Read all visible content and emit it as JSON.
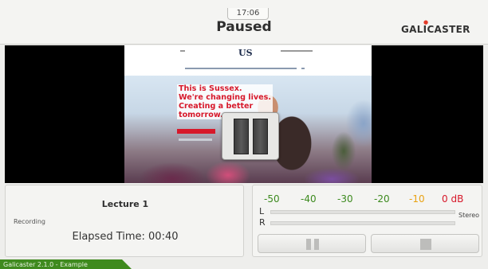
{
  "header": {
    "clock": "17:06",
    "status": "Paused",
    "logo": "GALICASTER"
  },
  "preview": {
    "site_logo": "US",
    "headline": [
      "This is Sussex.",
      "We're changing lives.",
      "Creating a better",
      "tomorrow."
    ]
  },
  "recording": {
    "title": "Lecture 1",
    "status_label": "Recording",
    "elapsed": "Elapsed Time: 00:40"
  },
  "audio": {
    "scale": [
      {
        "label": "-50",
        "color": "#3c8a1e"
      },
      {
        "label": "-40",
        "color": "#3c8a1e"
      },
      {
        "label": "-30",
        "color": "#3c8a1e"
      },
      {
        "label": "-20",
        "color": "#3c8a1e"
      },
      {
        "label": "-10",
        "color": "#e9a213"
      },
      {
        "label": "0 dB",
        "color": "#d7182a"
      }
    ],
    "left_label": "L",
    "right_label": "R",
    "mode": "Stereo"
  },
  "controls": {
    "pause_icon": "pause-icon",
    "stop_icon": "stop-icon"
  },
  "footer": {
    "version": "Galicaster 2.1.0 - Example"
  },
  "colors": {
    "accent_green": "#3f8a1e",
    "headline_red": "#d7182a"
  }
}
